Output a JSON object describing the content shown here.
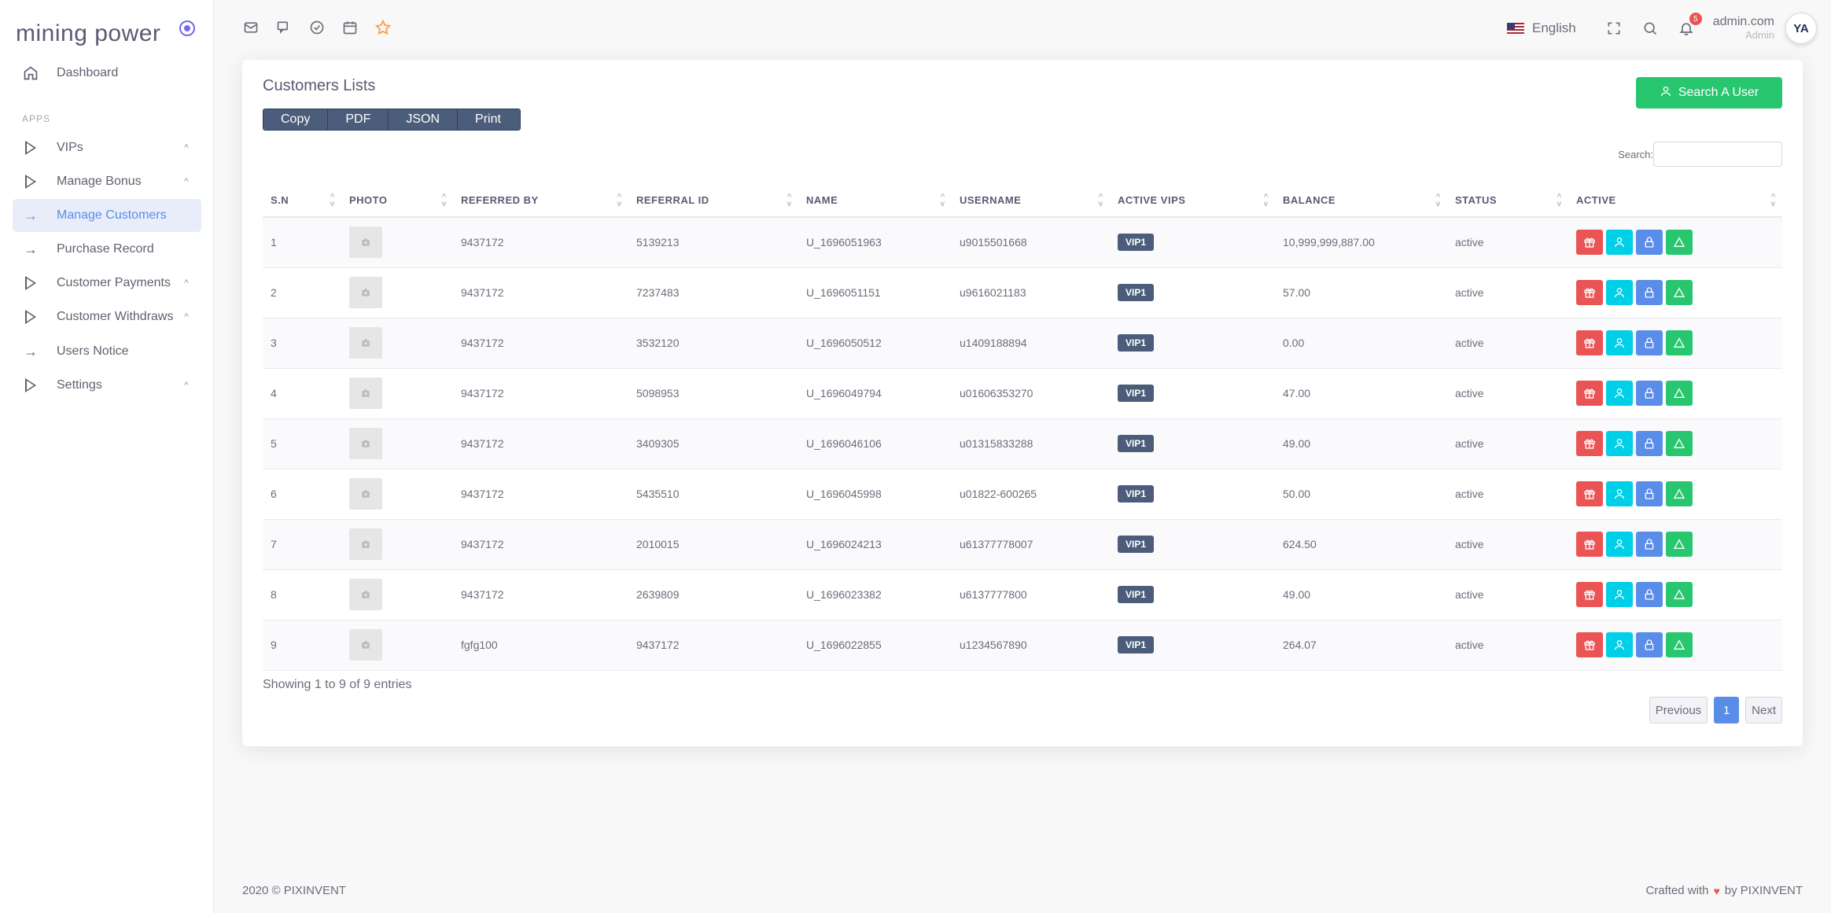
{
  "brand": {
    "name": "mining power"
  },
  "sidebar": {
    "dashboard": "Dashboard",
    "section": "APPS",
    "items": [
      {
        "label": "VIPs",
        "chevron": "^"
      },
      {
        "label": "Manage Bonus",
        "chevron": "^"
      },
      {
        "label": "Manage Customers"
      },
      {
        "label": "Purchase Record"
      },
      {
        "label": "Customer Payments",
        "chevron": "^"
      },
      {
        "label": "Customer Withdraws",
        "chevron": "^"
      },
      {
        "label": "Users Notice"
      },
      {
        "label": "Settings",
        "chevron": "^"
      }
    ]
  },
  "topbar": {
    "language": "English",
    "notification_count": "5",
    "user_name": "admin.com",
    "user_role": "Admin",
    "avatar_text": "YA"
  },
  "card": {
    "title": "Customers Lists",
    "export_buttons": [
      "Copy",
      "PDF",
      "JSON",
      "Print"
    ],
    "search_user_label": "Search A User",
    "search_label": "Search:"
  },
  "table": {
    "headers": [
      "S.N",
      "PHOTO",
      "REFERRED BY",
      "REFERRAL ID",
      "NAME",
      "USERNAME",
      "ACTIVE VIPS",
      "BALANCE",
      "STATUS",
      "ACTIVE"
    ],
    "rows": [
      {
        "sn": "1",
        "referred_by": "9437172",
        "referral_id": "5139213",
        "name": "U_1696051963",
        "username": "u9015501668",
        "vip": "VIP1",
        "balance": "10,999,999,887.00",
        "status": "active"
      },
      {
        "sn": "2",
        "referred_by": "9437172",
        "referral_id": "7237483",
        "name": "U_1696051151",
        "username": "u9616021183",
        "vip": "VIP1",
        "balance": "57.00",
        "status": "active"
      },
      {
        "sn": "3",
        "referred_by": "9437172",
        "referral_id": "3532120",
        "name": "U_1696050512",
        "username": "u1409188894",
        "vip": "VIP1",
        "balance": "0.00",
        "status": "active"
      },
      {
        "sn": "4",
        "referred_by": "9437172",
        "referral_id": "5098953",
        "name": "U_1696049794",
        "username": "u01606353270",
        "vip": "VIP1",
        "balance": "47.00",
        "status": "active"
      },
      {
        "sn": "5",
        "referred_by": "9437172",
        "referral_id": "3409305",
        "name": "U_1696046106",
        "username": "u01315833288",
        "vip": "VIP1",
        "balance": "49.00",
        "status": "active"
      },
      {
        "sn": "6",
        "referred_by": "9437172",
        "referral_id": "5435510",
        "name": "U_1696045998",
        "username": "u01822-600265",
        "vip": "VIP1",
        "balance": "50.00",
        "status": "active"
      },
      {
        "sn": "7",
        "referred_by": "9437172",
        "referral_id": "2010015",
        "name": "U_1696024213",
        "username": "u61377778007",
        "vip": "VIP1",
        "balance": "624.50",
        "status": "active"
      },
      {
        "sn": "8",
        "referred_by": "9437172",
        "referral_id": "2639809",
        "name": "U_1696023382",
        "username": "u6137777800",
        "vip": "VIP1",
        "balance": "49.00",
        "status": "active"
      },
      {
        "sn": "9",
        "referred_by": "fgfg100",
        "referral_id": "9437172",
        "name": "U_1696022855",
        "username": "u1234567890",
        "vip": "VIP1",
        "balance": "264.07",
        "status": "active"
      }
    ]
  },
  "pagination": {
    "showing": "Showing 1 to 9 of 9 entries",
    "previous": "Previous",
    "current": "1",
    "next": "Next"
  },
  "footer": {
    "copyright": "2020 © PIXINVENT",
    "crafted_prefix": "Crafted with",
    "crafted_suffix": "by PIXINVENT"
  },
  "colors": {
    "accent": "#5a8de8",
    "success": "#28c76f",
    "danger": "#ea5455",
    "info": "#00cfe8",
    "badge": "#4b5d7a"
  }
}
